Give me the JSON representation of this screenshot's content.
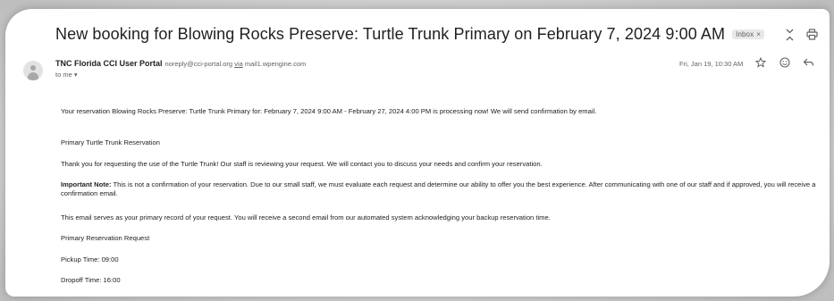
{
  "email": {
    "subject": "New booking for Blowing Rocks Preserve: Turtle Trunk Primary on February 7, 2024 9:00 AM",
    "label_chip": "Inbox",
    "label_chip_close": "×",
    "sender_name": "TNC Florida CCI User Portal",
    "sender_email": "noreply@cci-portal.org",
    "via_word": "via",
    "via_domain": "mail1.wpengine.com",
    "recipient": "to me ▾",
    "date": "Fri, Jan 19, 10:30 AM",
    "icons": {
      "expand": "expand-collapse-icon",
      "print": "print-icon",
      "star": "star-icon",
      "emoji": "emoji-reaction-icon",
      "reply": "reply-icon"
    },
    "body": {
      "p1": "Your reservation Blowing Rocks Preserve: Turtle Trunk Primary for: February 7, 2024 9:00 AM - February 27, 2024 4:00 PM is processing now! We will send confirmation by email.",
      "p2": "Primary Turtle Trunk Reservation",
      "p3": "Thank you for requesting the use of the Turtle Trunk! Our staff is reviewing your request. We will contact you to discuss your needs and confirm your reservation.",
      "p4_label": "Important Note:",
      "p4_text": " This is not a confirmation of your reservation. Due to our small staff, we must evaluate each request and determine our ability to offer you the best experience. After communicating with one of our staff and if approved, you will receive a confirmation email.",
      "p5": "This email serves as your primary record of your request. You will receive a second email from our automated system acknowledging your backup reservation time.",
      "p6": "Primary Reservation Request",
      "p7": "Pickup Time: 09:00",
      "p8": "Dropoff Time: 16:00"
    }
  }
}
